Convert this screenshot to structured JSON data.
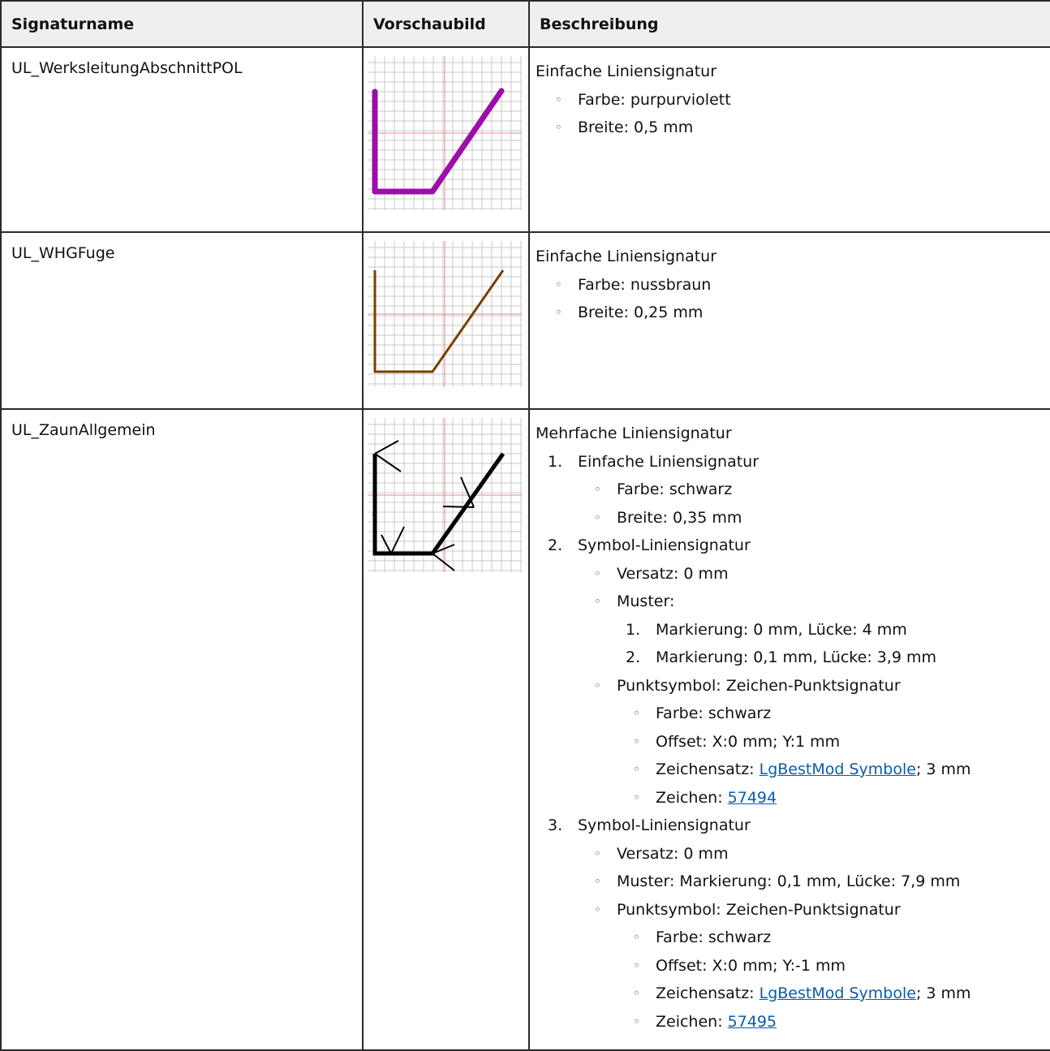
{
  "headers": {
    "name": "Signaturname",
    "preview": "Vorschaubild",
    "description": "Beschreibung"
  },
  "rows": [
    {
      "name": "UL_WerksleitungAbschnittPOL",
      "preview_color": "#9b0fa8",
      "head": "Einfache Liniensignatur",
      "items": [
        "Farbe: purpurviolett",
        "Breite: 0,5 mm"
      ]
    },
    {
      "name": "UL_WHGFuge",
      "preview_color": "#7a3f00",
      "head": "Einfache Liniensignatur",
      "items": [
        "Farbe: nussbraun",
        "Breite: 0,25 mm"
      ]
    },
    {
      "name": "UL_ZaunAllgemein",
      "preview_color": "#000000",
      "head": "Mehrfache Liniensignatur",
      "sub1": {
        "title": "Einfache Liniensignatur",
        "items": [
          "Farbe: schwarz",
          "Breite: 0,35 mm"
        ]
      },
      "sub2": {
        "title": "Symbol-Liniensignatur",
        "versatz": "Versatz: 0 mm",
        "muster": "Muster:",
        "muster_items": [
          "Markierung: 0 mm, Lücke: 4 mm",
          "Markierung: 0,1 mm, Lücke: 3,9 mm"
        ],
        "punkt": "Punktsymbol: Zeichen-Punktsignatur",
        "farbe": "Farbe: schwarz",
        "offset": "Offset: X:0 mm; Y:1 mm",
        "zeichensatz_prefix": "Zeichensatz: ",
        "zeichensatz_link": "LgBestMod Symbole",
        "zeichensatz_suffix": "; 3 mm",
        "zeichen_prefix": "Zeichen: ",
        "zeichen_link": "57494"
      },
      "sub3": {
        "title": "Symbol-Liniensignatur",
        "versatz": "Versatz: 0 mm",
        "muster": "Muster: Markierung: 0,1 mm, Lücke: 7,9 mm",
        "punkt": "Punktsymbol: Zeichen-Punktsignatur",
        "farbe": "Farbe: schwarz",
        "offset": "Offset: X:0 mm; Y:-1 mm",
        "zeichensatz_prefix": "Zeichensatz: ",
        "zeichensatz_link": "LgBestMod Symbole",
        "zeichensatz_suffix": "; 3 mm",
        "zeichen_prefix": "Zeichen: ",
        "zeichen_link": "57495"
      }
    }
  ],
  "colors": {
    "grid": "#c9c9c9",
    "grid_axis": "#e38a8a",
    "link": "#0b5cad"
  }
}
